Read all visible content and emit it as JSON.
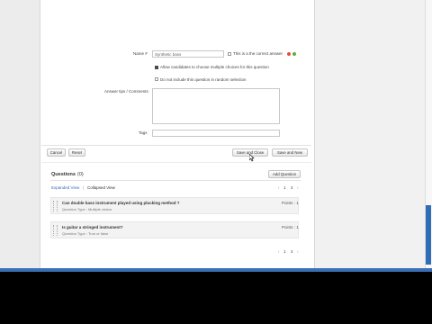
{
  "form": {
    "answer_label": "Name #",
    "answer_value": "Synthetic bass",
    "correct_label": "This is a the correct answer",
    "multi_choice_label": "Allow candidates to choose multiple choices for this question",
    "exclude_random_label": "Do not include this question in random selection",
    "comments_label": "Answer tips / Comments",
    "tags_label": "Tags",
    "status_colors": {
      "delete": "#e84c3d",
      "add": "#6aaa3a"
    }
  },
  "actions": {
    "cancel": "Cancel",
    "reset": "Reset",
    "save_close": "Save and Close",
    "save_new": "Save and New"
  },
  "questions": {
    "heading": "Questions",
    "count": "(0)",
    "add_button": "Add Question",
    "expanded_view": "Expanded View",
    "separator": "|",
    "collapsed_view": "Collapsed View",
    "pager": [
      "1",
      "2"
    ],
    "items": [
      {
        "title": "Can double bass instrument played using plucking method ?",
        "type_text": "Question Type : Multiple choice",
        "points": "Points : 1"
      },
      {
        "title": "Is guitar a stringed instrument?",
        "type_text": "Question Type : True or false",
        "points": "Points : 1"
      }
    ]
  }
}
